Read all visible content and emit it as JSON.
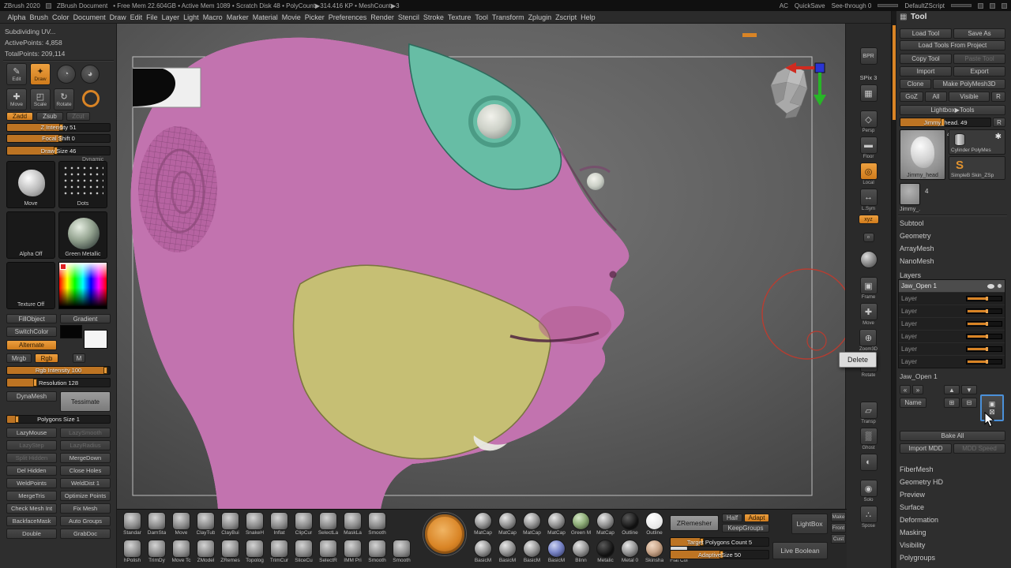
{
  "titlebar": {
    "app": "ZBrush 2020",
    "doc": "ZBrush Document",
    "stats": "• Free Mem 22.604GB • Active Mem 1089 • Scratch Disk 48 • PolyCount▶314.416 KP • MeshCount▶3",
    "ac": "AC",
    "quicksave": "QuickSave",
    "seethrough": "See-through 0",
    "zscript": "DefaultZScript"
  },
  "menus": [
    "Alpha",
    "Brush",
    "Color",
    "Document",
    "Draw",
    "Edit",
    "File",
    "Layer",
    "Light",
    "Macro",
    "Marker",
    "Material",
    "Movie",
    "Picker",
    "Preferences",
    "Render",
    "Stencil",
    "Stroke",
    "Texture",
    "Tool",
    "Transform",
    "Zplugin",
    "Zscript",
    "Help"
  ],
  "colors": {
    "head": "#c273af",
    "teal": "#67bda5",
    "jaw": "#c6bf74",
    "accent": "#d98425",
    "ring": "#c23a2c"
  },
  "icons": {
    "edit": "✎",
    "draw": "✦",
    "move": "✚",
    "scale": "◰",
    "rotate": "↻",
    "picker1": "◔",
    "picker2": "◕",
    "palette": "▦",
    "star": "✱",
    "s_badge": "S",
    "up": "▲",
    "down": "▼",
    "dup": "⊞",
    "merge": "⊟",
    "del1": "⊠",
    "del2": "▣",
    "back": "«",
    "fwd": "»"
  },
  "left_panel": {
    "status1": "Subdividing UV...",
    "status2": "ActivePoints: 4,858",
    "status3": "TotalPoints: 209,114",
    "edit": "Edit",
    "draw": "Draw",
    "move": "Move",
    "scale": "Scale",
    "rotate": "Rotate",
    "zadd": "Zadd",
    "zsub": "Zsub",
    "zcut": "Zcut",
    "z_intensity": "Z Intensity 51",
    "focal_shift": "Focal Shift 0",
    "draw_size": "Draw Size 46",
    "dynamic": "Dynamic",
    "brush_tile": "Move",
    "stroke_tile": "Dots",
    "alpha_tile": "Alpha Off",
    "material_tile": "Green Metallic",
    "texture_tile": "Texture Off",
    "fill_object": "FillObject",
    "gradient": "Gradient",
    "switch_color": "SwitchColor",
    "alternate": "Alternate",
    "mrgb": "Mrgb",
    "rgb": "Rgb",
    "m": "M",
    "rgb_intensity": "Rgb Intensity 100",
    "resolution": "Resolution 128",
    "dynamesh": "DynaMesh",
    "tessimate": "Tessimate",
    "polygons_size": "Polygons Size 1",
    "rows": [
      {
        "a": "LazyMouse",
        "ac": "",
        "b": "LazySmooth",
        "bc": "dim"
      },
      {
        "a": "LazyStep",
        "ac": "dim",
        "b": "LazyRadius",
        "bc": "dim"
      },
      {
        "a": "Split Hidden",
        "ac": "dim",
        "b": "MergeDown",
        "bc": ""
      },
      {
        "a": "Del Hidden",
        "ac": "",
        "b": "Close Holes",
        "bc": ""
      },
      {
        "a": "WeldPoints",
        "ac": "",
        "b": "WeldDist 1",
        "bc": ""
      },
      {
        "a": "MergeTris",
        "ac": "",
        "b": "Optimize Points",
        "bc": ""
      },
      {
        "a": "Check Mesh Int",
        "ac": "",
        "b": "Fix Mesh",
        "bc": ""
      },
      {
        "a": "BackfaceMask",
        "ac": "",
        "b": "Auto Groups",
        "bc": ""
      },
      {
        "a": "Double",
        "ac": "",
        "b": "GrabDoc",
        "bc": ""
      }
    ]
  },
  "shelf": [
    {
      "glyph": "BPR",
      "label": "",
      "kind": "t7"
    },
    {
      "glyph": "",
      "label": "SPix 3",
      "kind": "textonly"
    },
    {
      "glyph": "▦",
      "label": "",
      "kind": ""
    },
    {
      "glyph": "◇",
      "label": "Persp",
      "kind": ""
    },
    {
      "glyph": "▬",
      "label": "Floor",
      "kind": ""
    },
    {
      "glyph": "◎",
      "label": "Local",
      "kind": "orange"
    },
    {
      "glyph": "↔",
      "label": "L.Sym",
      "kind": ""
    },
    {
      "glyph": "xyz",
      "label": "",
      "kind": "wide orange t7"
    },
    {
      "glyph": "◦",
      "label": "",
      "kind": "mini"
    },
    {
      "glyph": "",
      "label": "",
      "kind": "sphere"
    },
    {
      "glyph": "▣",
      "label": "Frame",
      "kind": ""
    },
    {
      "glyph": "✚",
      "label": "Move",
      "kind": ""
    },
    {
      "glyph": "⊕",
      "label": "Zoom3D",
      "kind": ""
    },
    {
      "glyph": "↻",
      "label": "Rotate",
      "kind": ""
    },
    {
      "glyph": "▱",
      "label": "Transp",
      "kind": "gap"
    },
    {
      "glyph": "▒",
      "label": "Ghost",
      "kind": ""
    },
    {
      "glyph": "◐",
      "label": "",
      "kind": ""
    },
    {
      "glyph": "◉",
      "label": "Solo",
      "kind": ""
    },
    {
      "glyph": "∴",
      "label": "Spose",
      "kind": ""
    }
  ],
  "tooltip": "Delete",
  "tool_panel": {
    "title": "Tool",
    "load_tool": "Load Tool",
    "save_as": "Save As",
    "load_project": "Load Tools From Project",
    "copy_tool": "Copy Tool",
    "paste_tool": "Paste Tool",
    "import": "Import",
    "export": "Export",
    "clone": "Clone",
    "make_poly": "Make PolyMesh3D",
    "goz": "GoZ",
    "all": "All",
    "visible": "Visible",
    "r": "R",
    "lightbox_tools": "Lightbox▶Tools",
    "active_tool": "Jimmy_head. 49",
    "r2": "R",
    "thumb_label": "Jimmy_head",
    "thumb_count": "4",
    "slot1": "Cylinder PolyMes",
    "slot2": "SimpleB Skin_ZSp",
    "mini_label": "Jimmy_.",
    "mini_count": "4",
    "sections_top": [
      "Subtool",
      "Geometry",
      "ArrayMesh",
      "NanoMesh"
    ],
    "layers_title": "Layers",
    "layers": [
      {
        "name": "Jaw_Open 1",
        "cls": "selected"
      },
      {
        "name": "Layer",
        "cls": ""
      },
      {
        "name": "Layer",
        "cls": ""
      },
      {
        "name": "Layer",
        "cls": ""
      },
      {
        "name": "Layer",
        "cls": ""
      },
      {
        "name": "Layer",
        "cls": ""
      },
      {
        "name": "Layer",
        "cls": ""
      }
    ],
    "current_layer": "Jaw_Open 1",
    "name_btn": "Name",
    "bake_all": "Bake All",
    "import_mdd": "Import MDD",
    "mdd_speed": "MDD Speed",
    "sections_bottom": [
      "FiberMesh",
      "Geometry HD",
      "Preview",
      "Surface",
      "Deformation",
      "Masking",
      "Visibility",
      "Polygroups"
    ]
  },
  "tray": {
    "brushes_row1": [
      "Standar",
      "DamSta",
      "Move",
      "ClayTub",
      "ClayBui",
      "SnakeH",
      "Inflat",
      "ClipCur",
      "SelectLa",
      "MaskLa",
      "Smooth"
    ],
    "brushes_row2": [
      "hPolish",
      "TrimDy",
      "Move Tc",
      "ZModel",
      "ZRemes",
      "Topolog",
      "TrimCur",
      "SliceCu",
      "SelectR",
      "IMM Pri",
      "Smooth",
      "Smooth"
    ],
    "materials_row1": [
      {
        "label": "MatCap",
        "cls": ""
      },
      {
        "label": "MatCap",
        "cls": ""
      },
      {
        "label": "MatCap",
        "cls": ""
      },
      {
        "label": "MatCap",
        "cls": ""
      },
      {
        "label": "Green M",
        "cls": "t-green"
      },
      {
        "label": "MatCap",
        "cls": ""
      },
      {
        "label": "Outline",
        "cls": "t-black"
      },
      {
        "label": "Outline",
        "cls": "t-white"
      }
    ],
    "materials_row2": [
      {
        "label": "BasicM",
        "cls": ""
      },
      {
        "label": "BasicM",
        "cls": ""
      },
      {
        "label": "BasicM",
        "cls": ""
      },
      {
        "label": "BasicM",
        "cls": "t-blue"
      },
      {
        "label": "Blinn",
        "cls": ""
      },
      {
        "label": "Metalic",
        "cls": "t-black"
      },
      {
        "label": "Metal 0",
        "cls": ""
      },
      {
        "label": "Skinsha",
        "cls": "t-skin"
      },
      {
        "label": "Flat Col",
        "cls": "t-flat"
      }
    ],
    "zremesher": "ZRemesher",
    "half": "Half",
    "adapt": "Adapt",
    "keep_groups": "KeepGroups",
    "target_polygons": "Target Polygons Count 5",
    "adaptive_size": "AdaptiveSize 50",
    "lightbox": "LightBox",
    "live_boolean": "Live Boolean",
    "edge": [
      "Make",
      "Front",
      "Cust"
    ]
  }
}
